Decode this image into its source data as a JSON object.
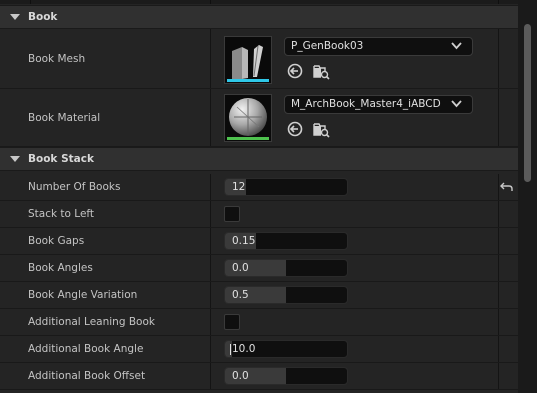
{
  "categories": {
    "book": {
      "title": "Book"
    },
    "book_stack": {
      "title": "Book Stack"
    }
  },
  "book": {
    "mesh": {
      "label": "Book Mesh",
      "asset": "P_GenBook03",
      "thumb_icon": "book-mesh-thumbnail",
      "bar_color": "#2fc8e8"
    },
    "material": {
      "label": "Book Material",
      "asset": "M_ArchBook_Master4_iABCD",
      "thumb_icon": "sphere-material-thumbnail",
      "bar_color": "#4ec24e"
    }
  },
  "stack": {
    "number_of_books": {
      "label": "Number Of Books",
      "value": "12",
      "fill_fraction": 0.17
    },
    "stack_to_left": {
      "label": "Stack to Left",
      "checked": false
    },
    "book_gaps": {
      "label": "Book Gaps",
      "value": "0.15",
      "fill_fraction": 0.25
    },
    "book_angles": {
      "label": "Book Angles",
      "value": "0.0",
      "fill_fraction": 0.5
    },
    "book_angle_variation": {
      "label": "Book Angle Variation",
      "value": "0.5",
      "fill_fraction": 0.5
    },
    "additional_leaning_book": {
      "label": "Additional Leaning Book",
      "checked": false
    },
    "additional_book_angle": {
      "label": "Additional Book Angle",
      "value": "10.0",
      "fill_fraction": 0.06
    },
    "additional_book_offset": {
      "label": "Additional Book Offset",
      "value": "0.0",
      "fill_fraction": 0.5
    }
  },
  "icons": {
    "use_selected": "arrow-left-circle-icon",
    "browse": "folder-search-icon",
    "reset": "reset-arrow-icon",
    "dropdown": "chevron-down-icon",
    "expand": "triangle-down-icon"
  }
}
